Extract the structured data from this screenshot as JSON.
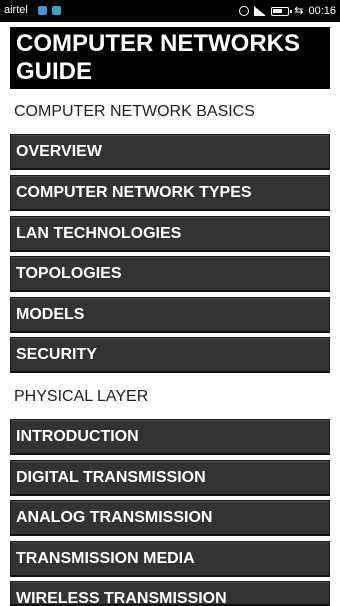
{
  "status_bar": {
    "carrier": "airtel",
    "time": "00:16"
  },
  "app": {
    "title": "COMPUTER NETWORKS GUIDE"
  },
  "sections": [
    {
      "header": "COMPUTER NETWORK BASICS",
      "items": [
        "OVERVIEW",
        "COMPUTER NETWORK TYPES",
        "LAN TECHNOLOGIES",
        "TOPOLOGIES",
        "MODELS",
        "SECURITY"
      ]
    },
    {
      "header": "PHYSICAL LAYER",
      "items": [
        "INTRODUCTION",
        "DIGITAL TRANSMISSION",
        "ANALOG TRANSMISSION",
        "TRANSMISSION MEDIA",
        "WIRELESS TRANSMISSION"
      ]
    }
  ],
  "colors": {
    "title_bg": "#000000",
    "item_bg": "#333333",
    "item_text": "#ffffff"
  }
}
